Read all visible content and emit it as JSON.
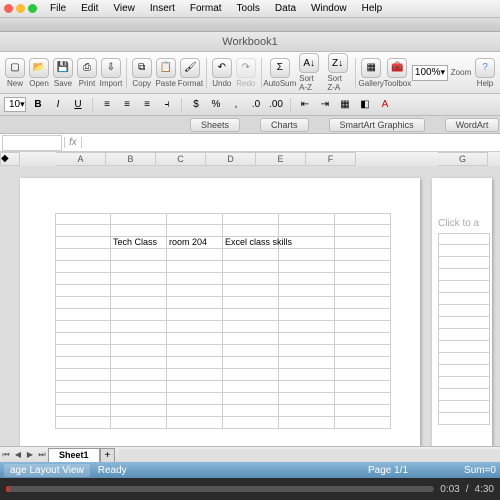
{
  "menu": {
    "items": [
      "File",
      "Edit",
      "View",
      "Insert",
      "Format",
      "Tools",
      "Data",
      "Window",
      "Help"
    ]
  },
  "window": {
    "title": "Workbook1"
  },
  "toolbar": {
    "new": "New",
    "open": "Open",
    "save": "Save",
    "print": "Print",
    "import": "Import",
    "copy": "Copy",
    "paste": "Paste",
    "format": "Format",
    "undo": "Undo",
    "redo": "Redo",
    "autosum": "AutoSum",
    "sortaz": "Sort A-Z",
    "sortza": "Sort Z-A",
    "gallery": "Gallery",
    "toolbox": "Toolbox",
    "zoom": "Zoom",
    "help": "Help",
    "zoomlevel": "100%"
  },
  "format": {
    "fontsize": "10",
    "bold": "B",
    "italic": "I",
    "underline": "U"
  },
  "ribbon": {
    "sheets": "Sheets",
    "charts": "Charts",
    "smartart": "SmartArt Graphics",
    "wordart": "WordArt"
  },
  "formula": {
    "fx": "fx"
  },
  "columns": [
    "A",
    "B",
    "C",
    "D",
    "E",
    "F"
  ],
  "columns_right": [
    "G"
  ],
  "cells": {
    "b5": "Tech Class",
    "c5": "room 204",
    "d5": "Excel class skills"
  },
  "page2": {
    "placeholder": "Click to a"
  },
  "sheets": {
    "active": "Sheet1",
    "add": "+"
  },
  "status": {
    "view": "age Layout View",
    "ready": "Ready",
    "page": "Page 1/1",
    "sum": "Sum=0"
  },
  "video": {
    "elapsed": "0:03",
    "total": "4:30"
  }
}
